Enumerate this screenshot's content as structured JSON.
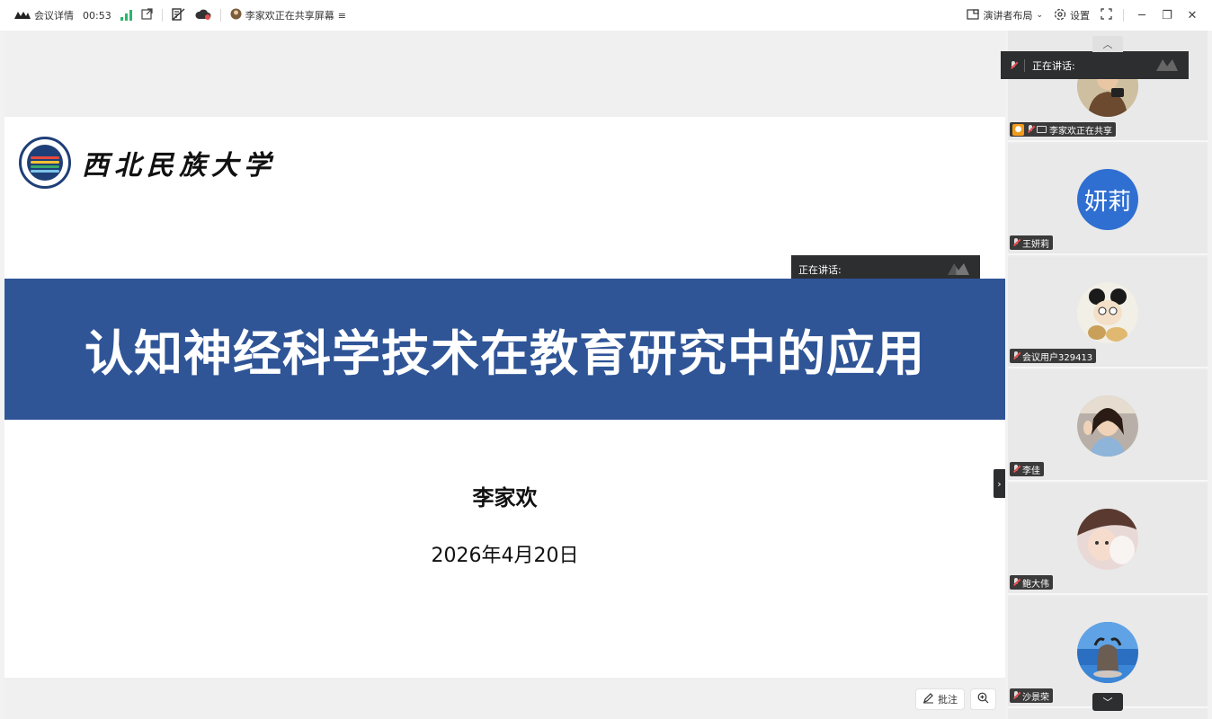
{
  "topbar": {
    "meeting_info": "会议详情",
    "timer": "00:53",
    "sharing_status": "李家欢正在共享屏幕",
    "layout_label": "演讲者布局",
    "settings_label": "设置"
  },
  "slide": {
    "university_name": "西北民族大学",
    "title": "认知神经科学技术在教育研究中的应用",
    "author": "李家欢",
    "date": "2026年4月20日"
  },
  "speaking": {
    "label": "正在讲话:"
  },
  "tools": {
    "annotate_label": "批注"
  },
  "participants": [
    {
      "name": "李家欢正在共享",
      "avatar_text": ""
    },
    {
      "name": "王妍莉",
      "avatar_text": "妍莉"
    },
    {
      "name": "会议用户329413",
      "avatar_text": ""
    },
    {
      "name": "李佳",
      "avatar_text": ""
    },
    {
      "name": "鲍大伟",
      "avatar_text": ""
    },
    {
      "name": "沙景荣",
      "avatar_text": ""
    }
  ],
  "colors": {
    "title_band": "#2f5597",
    "signal": "#2db56b",
    "avatar_blue": "#2f6fd1",
    "host_badge": "#f29b1b"
  }
}
